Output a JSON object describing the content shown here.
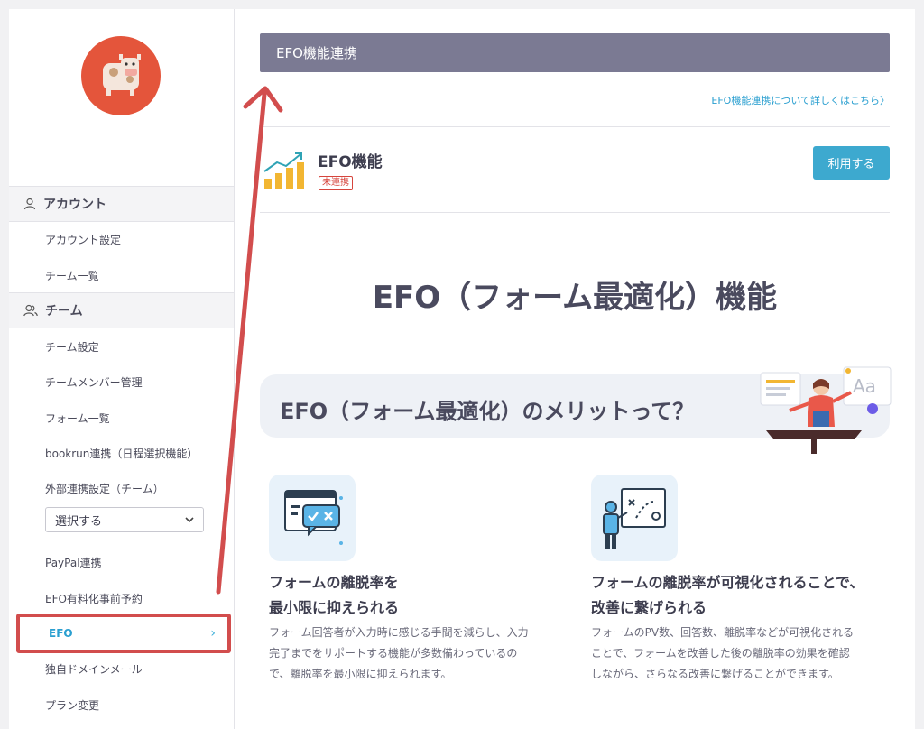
{
  "sidebar": {
    "account_section": "アカウント",
    "account_items": [
      "アカウント設定",
      "チーム一覧"
    ],
    "team_section": "チーム",
    "team_items": [
      "チーム設定",
      "チームメンバー管理",
      "フォーム一覧",
      "bookrun連携（日程選択機能）"
    ],
    "external_label": "外部連携設定（チーム）",
    "select_value": "選択する",
    "after_items": [
      "PayPal連携",
      "EFO有料化事前予約"
    ],
    "active_item": "EFO",
    "bottom_items": [
      "独自ドメインメール",
      "プラン変更"
    ]
  },
  "main": {
    "title": "EFO機能連携",
    "detail_link": "EFO機能連携について詳しくはこちら〉",
    "feature_name": "EFO機能",
    "feature_badge": "未連携",
    "use_button": "利用する",
    "hero_title": "EFO（フォーム最適化）機能",
    "merit_title": "EFO（フォーム最適化）のメリットって？",
    "cards": [
      {
        "title_line1": "フォームの離脱率を",
        "title_line2": "最小限に抑えられる",
        "desc_lines": [
          "フォーム回答者が入力時に感じる手間を減らし、入力",
          "完了までをサポートする機能が多数備わっているの",
          "で、離脱率を最小限に抑えられます。"
        ]
      },
      {
        "title_line1": "フォームの離脱率が可視化されることで、",
        "title_line2": "改善に繋げられる",
        "desc_lines": [
          "フォームのPV数、回答数、離脱率などが可視化される",
          "ことで、フォームを改善した後の離脱率の効果を確認",
          "しながら、さらなる改善に繋げることができます。"
        ]
      }
    ]
  },
  "colors": {
    "accent": "#3da9cf",
    "title_bar": "#7b7a93",
    "highlight": "#d24d4d",
    "badge": "#d6453d"
  }
}
